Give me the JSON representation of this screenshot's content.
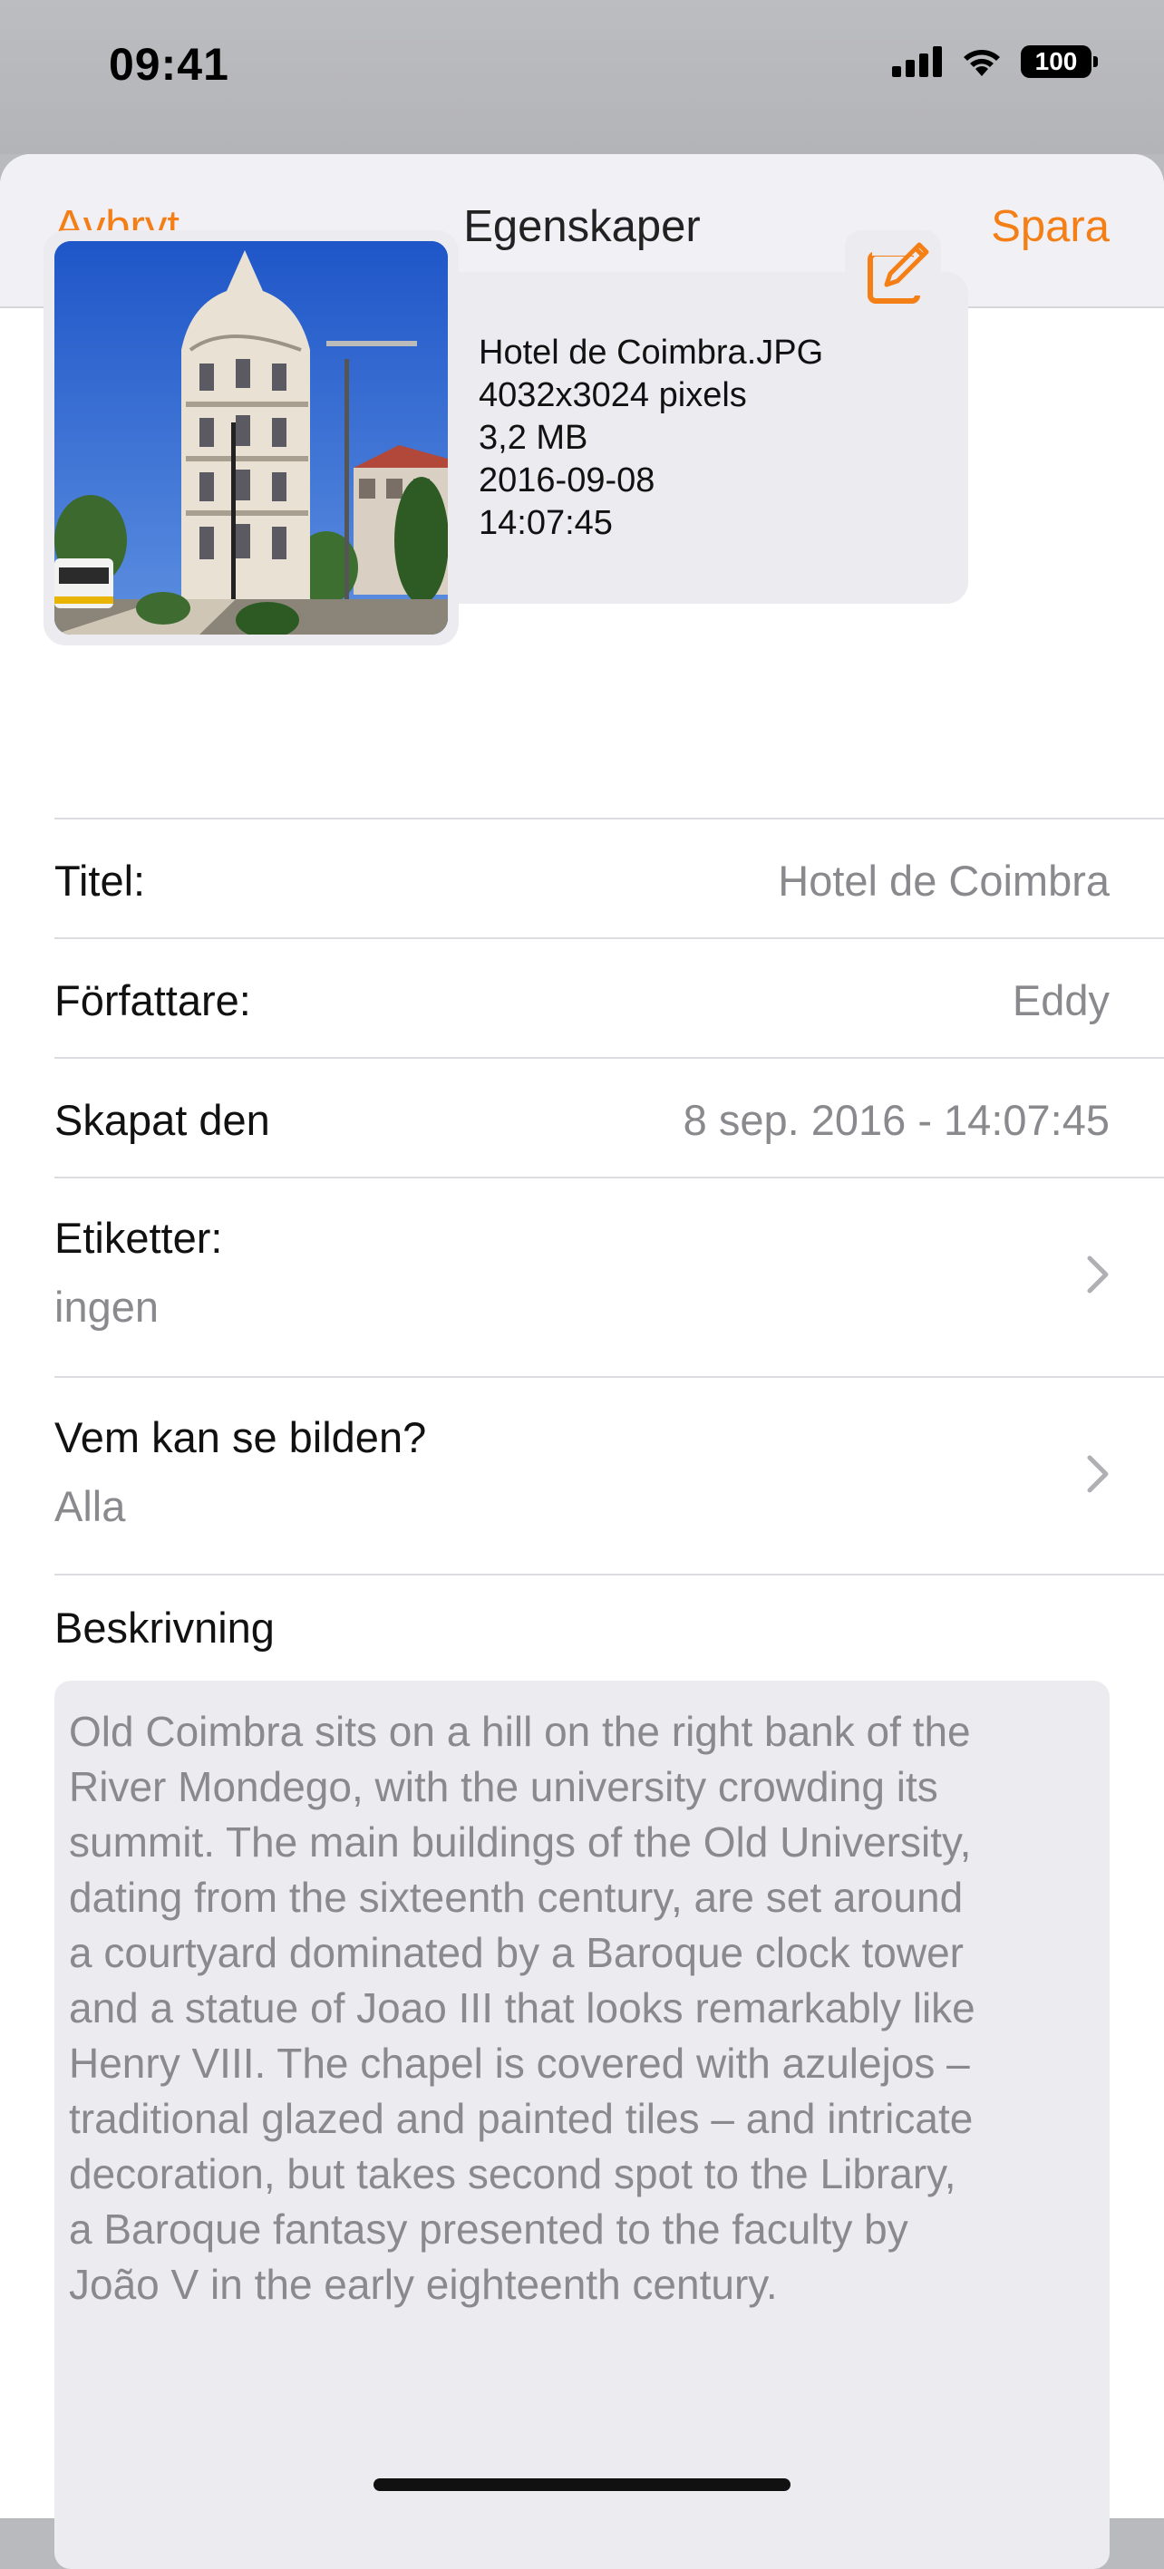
{
  "status_bar": {
    "time": "09:41",
    "battery": "100"
  },
  "nav": {
    "cancel": "Avbryt",
    "title": "Egenskaper",
    "save": "Spara"
  },
  "file": {
    "name": "Hotel de Coimbra.JPG",
    "dimensions": "4032x3024 pixels",
    "size": "3,2 MB",
    "date": "2016-09-08",
    "time": "14:07:45"
  },
  "fields": {
    "title_label": "Titel:",
    "title_value": "Hotel de Coimbra",
    "author_label": "Författare:",
    "author_value": "Eddy",
    "created_label": "Skapat den",
    "created_value": "8 sep. 2016 - 14:07:45",
    "tags_label": "Etiketter:",
    "tags_value": "ingen",
    "visibility_label": "Vem kan se bilden?",
    "visibility_value": "Alla"
  },
  "description": {
    "label": "Beskrivning",
    "text": "Old Coimbra sits on a hill on the right bank of the\nRiver Mondego, with the university crowding its\nsummit. The main buildings of the Old University,\ndating from the sixteenth century, are set around\na courtyard dominated by a Baroque clock tower\nand a statue of Joao III that looks remarkably like\nHenry VIII. The chapel is covered with azulejos –\ntraditional glazed and painted tiles – and intricate\ndecoration, but takes second spot to the Library,\na Baroque fantasy presented to the faculty by\nJoão V in the early eighteenth century."
  },
  "colors": {
    "accent": "#f57f17",
    "secondary_text": "#8a8a8e",
    "card_bg": "#ececf0"
  },
  "icons": {
    "edit": "square-pencil-icon",
    "chevron": "chevron-right-icon"
  }
}
